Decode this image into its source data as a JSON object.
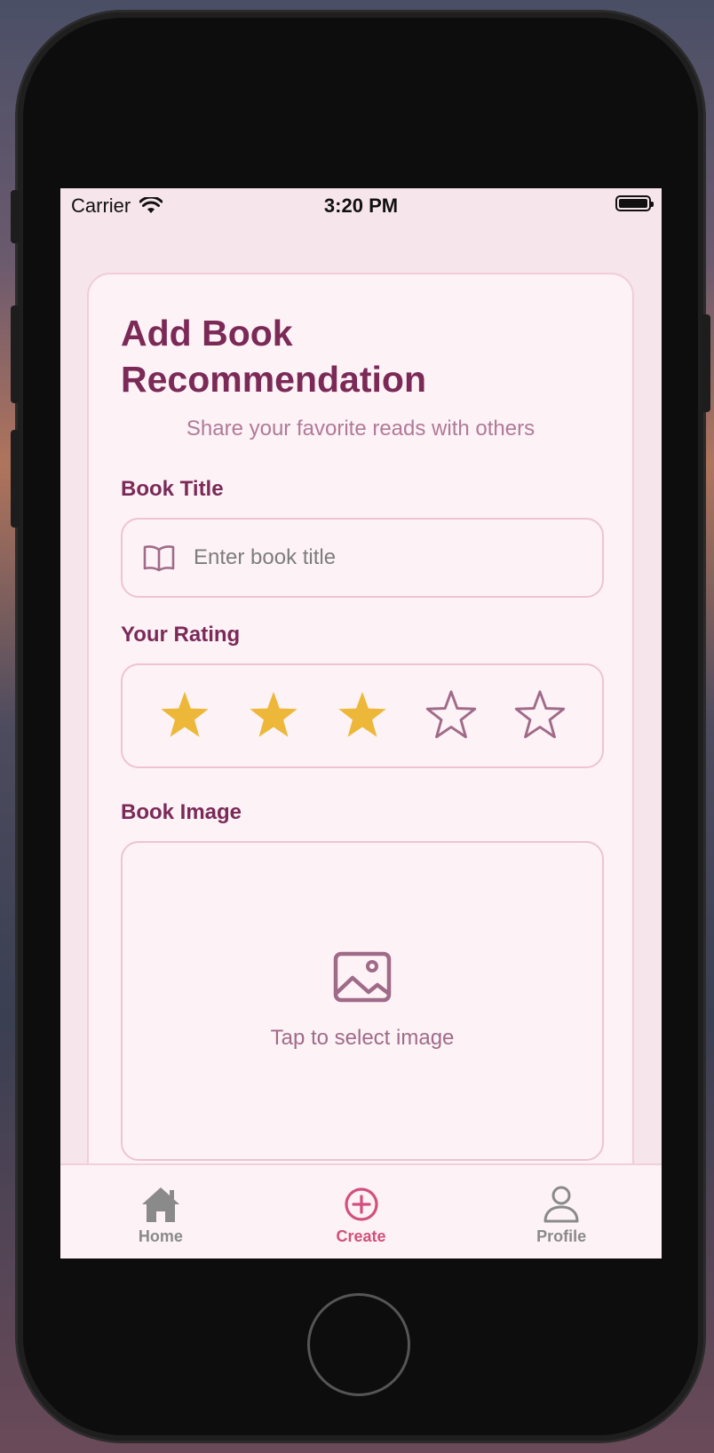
{
  "status_bar": {
    "carrier": "Carrier",
    "time": "3:20 PM",
    "wifi_icon": "wifi-icon",
    "battery_icon": "battery-icon"
  },
  "form": {
    "title": "Add Book Recommendation",
    "subtitle": "Share your favorite reads with others",
    "book_title": {
      "label": "Book Title",
      "placeholder": "Enter book title",
      "value": "",
      "icon": "book-open-icon"
    },
    "rating": {
      "label": "Your Rating",
      "value": 3,
      "max": 5,
      "filled_color": "#EDB83A",
      "empty_color": "#A06B89"
    },
    "image": {
      "label": "Book Image",
      "prompt": "Tap to select image",
      "icon": "image-icon"
    }
  },
  "tab_bar": {
    "active": "Create",
    "tabs": [
      {
        "label": "Home",
        "icon": "home-icon"
      },
      {
        "label": "Create",
        "icon": "plus-circle-icon"
      },
      {
        "label": "Profile",
        "icon": "profile-icon"
      }
    ]
  },
  "colors": {
    "accent": "#7B2A58",
    "active_tab": "#D2507E",
    "background": "#F7E5EC",
    "card": "#FDF2F5"
  }
}
